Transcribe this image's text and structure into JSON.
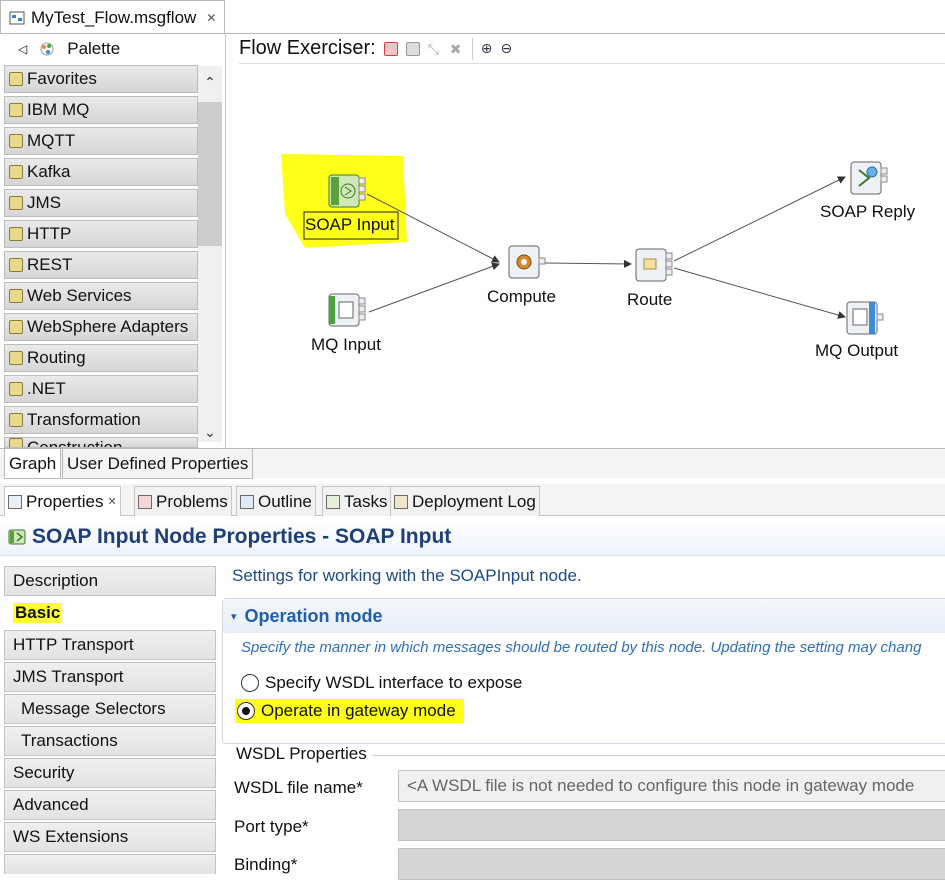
{
  "editor": {
    "tab_title": "MyTest_Flow.msgflow",
    "close_glyph": "✕"
  },
  "palette": {
    "label": "Palette",
    "drawers": [
      "Favorites",
      "IBM MQ",
      "MQTT",
      "Kafka",
      "JMS",
      "HTTP",
      "REST",
      "Web Services",
      "WebSphere Adapters",
      "Routing",
      ".NET",
      "Transformation",
      "Construction"
    ]
  },
  "canvas": {
    "toolbar_title": "Flow Exerciser:",
    "nodes": {
      "soap_input": "SOAP Input",
      "mq_input": "MQ Input",
      "compute": "Compute",
      "route": "Route",
      "soap_reply": "SOAP Reply",
      "mq_output": "MQ Output"
    },
    "highlight_color": "#ffff1a"
  },
  "bottom_tabs": [
    "Graph",
    "User Defined Properties"
  ],
  "views": {
    "tabs": [
      "Properties",
      "Problems",
      "Outline",
      "Tasks",
      "Deployment Log"
    ]
  },
  "properties": {
    "title": "SOAP Input Node Properties - SOAP Input",
    "nav": [
      "Description",
      "Basic",
      "HTTP Transport",
      "JMS Transport",
      "Message Selectors",
      "Transactions",
      "Security",
      "Advanced",
      "WS Extensions"
    ],
    "settings_desc": "Settings for working with the SOAPInput node.",
    "operation_mode": {
      "heading": "Operation mode",
      "hint": "Specify the manner in which messages should be routed by this node.  Updating the setting may chang",
      "option_wsdl": "Specify WSDL interface to expose",
      "option_gateway": "Operate in gateway mode",
      "selected": "Operate in gateway mode"
    },
    "wsdl": {
      "legend": "WSDL Properties",
      "file_label": "WSDL file name*",
      "file_placeholder": "<A WSDL file is not needed to configure this node in gateway mode",
      "port_label": "Port type*",
      "binding_label": "Binding*"
    }
  }
}
